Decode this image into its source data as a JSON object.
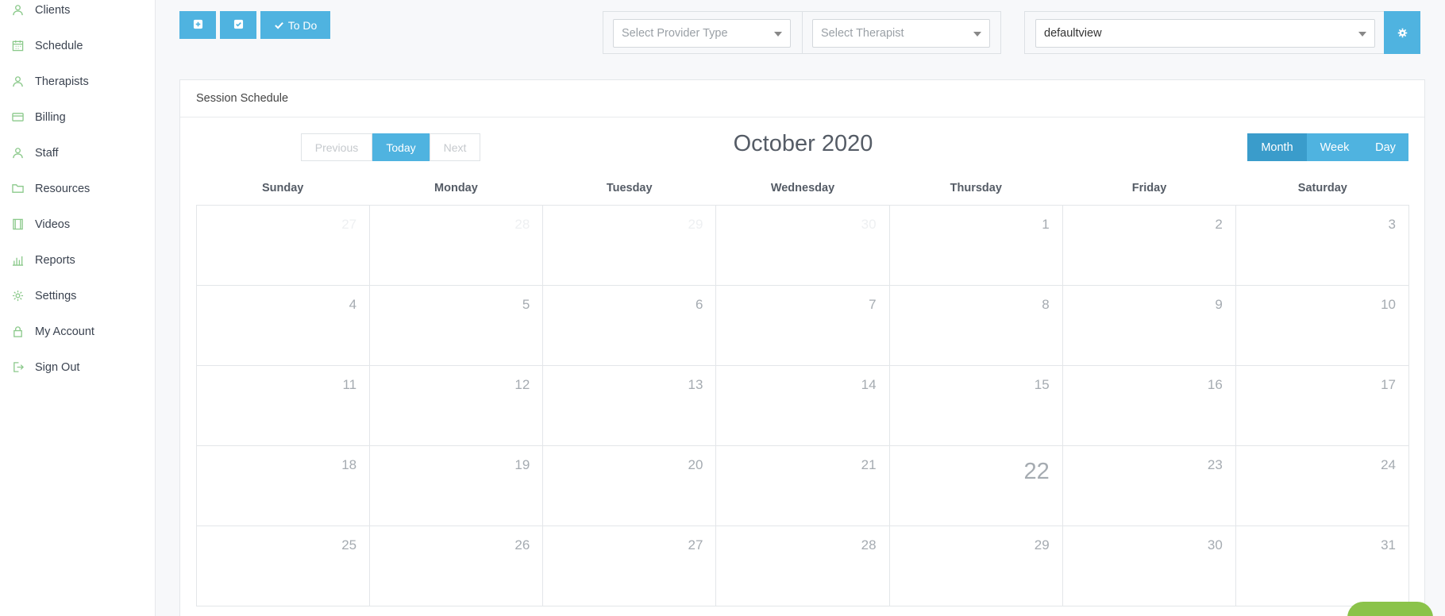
{
  "sidebar": {
    "items": [
      {
        "label": "Clients",
        "icon": "user-icon"
      },
      {
        "label": "Schedule",
        "icon": "calendar-icon"
      },
      {
        "label": "Therapists",
        "icon": "user-icon"
      },
      {
        "label": "Billing",
        "icon": "credit-card-icon"
      },
      {
        "label": "Staff",
        "icon": "user-icon"
      },
      {
        "label": "Resources",
        "icon": "folder-icon"
      },
      {
        "label": "Videos",
        "icon": "film-icon"
      },
      {
        "label": "Reports",
        "icon": "bar-chart-icon"
      },
      {
        "label": "Settings",
        "icon": "gear-icon"
      },
      {
        "label": "My Account",
        "icon": "lock-icon"
      },
      {
        "label": "Sign Out",
        "icon": "sign-out-icon"
      }
    ]
  },
  "toolbar": {
    "add_icon": "plus-square-icon",
    "check_icon": "check-square-icon",
    "todo_label": "To Do"
  },
  "filters": {
    "provider_type_placeholder": "Select Provider Type",
    "therapist_placeholder": "Select Therapist",
    "view_value": "defaultview"
  },
  "panel": {
    "title": "Session Schedule"
  },
  "calendar": {
    "month_title": "October 2020",
    "nav": {
      "previous": "Previous",
      "today": "Today",
      "next": "Next"
    },
    "views": {
      "month": "Month",
      "week": "Week",
      "day": "Day",
      "active": "Month"
    },
    "weekdays": [
      "Sunday",
      "Monday",
      "Tuesday",
      "Wednesday",
      "Thursday",
      "Friday",
      "Saturday"
    ],
    "weeks": [
      [
        {
          "d": "27",
          "other": true
        },
        {
          "d": "28",
          "other": true
        },
        {
          "d": "29",
          "other": true
        },
        {
          "d": "30",
          "other": true
        },
        {
          "d": "1"
        },
        {
          "d": "2"
        },
        {
          "d": "3"
        }
      ],
      [
        {
          "d": "4"
        },
        {
          "d": "5"
        },
        {
          "d": "6"
        },
        {
          "d": "7"
        },
        {
          "d": "8"
        },
        {
          "d": "9"
        },
        {
          "d": "10"
        }
      ],
      [
        {
          "d": "11"
        },
        {
          "d": "12"
        },
        {
          "d": "13"
        },
        {
          "d": "14"
        },
        {
          "d": "15"
        },
        {
          "d": "16"
        },
        {
          "d": "17"
        }
      ],
      [
        {
          "d": "18"
        },
        {
          "d": "19"
        },
        {
          "d": "20"
        },
        {
          "d": "21"
        },
        {
          "d": "22",
          "today": true
        },
        {
          "d": "23"
        },
        {
          "d": "24"
        }
      ],
      [
        {
          "d": "25"
        },
        {
          "d": "26"
        },
        {
          "d": "27"
        },
        {
          "d": "28"
        },
        {
          "d": "29"
        },
        {
          "d": "30"
        },
        {
          "d": "31"
        }
      ]
    ]
  },
  "colors": {
    "accent": "#4fb3e0",
    "accent_dark": "#3a9ccb",
    "sidebar_icon": "#8bc98b",
    "help": "#8bc34a"
  }
}
